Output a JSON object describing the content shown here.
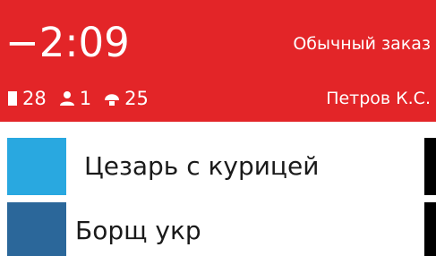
{
  "colors": {
    "header_bg": "#e32528",
    "item1_swatch": "#29a8e0",
    "item2_swatch": "#2b679a",
    "edge_bar": "#000000"
  },
  "header": {
    "timer": "−2:09",
    "order_type": "Обычный заказ",
    "table_number": "28",
    "guests_count": "1",
    "items_count": "25",
    "waiter": "Петров К.С.",
    "icons": {
      "table": "table-icon",
      "guests": "person-icon",
      "items": "dish-icon"
    }
  },
  "items": [
    {
      "name": "Цезарь с курицей"
    },
    {
      "name": "Борщ укр"
    }
  ]
}
